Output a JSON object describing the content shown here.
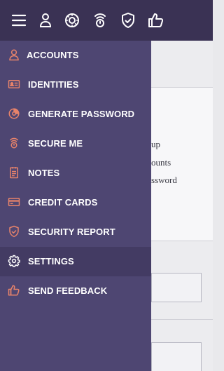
{
  "topbar": {
    "icons": [
      "hamburger-menu-icon",
      "account-icon",
      "generate-password-icon",
      "secure-me-icon",
      "security-shield-icon",
      "thumbs-up-icon"
    ]
  },
  "menu": {
    "items": [
      {
        "label": "ACCOUNTS",
        "icon": "user-icon"
      },
      {
        "label": "IDENTITIES",
        "icon": "id-card-icon"
      },
      {
        "label": "GENERATE PASSWORD",
        "icon": "password-dial-icon"
      },
      {
        "label": "SECURE ME",
        "icon": "secure-me-icon"
      },
      {
        "label": "NOTES",
        "icon": "notes-icon"
      },
      {
        "label": "CREDIT CARDS",
        "icon": "credit-card-icon"
      },
      {
        "label": "SECURITY REPORT",
        "icon": "shield-check-icon"
      },
      {
        "label": "SETTINGS",
        "icon": "gear-icon"
      },
      {
        "label": "SEND FEEDBACK",
        "icon": "thumbs-up-icon"
      }
    ],
    "active_item": "SETTINGS"
  },
  "background_page": {
    "lines": [
      "up",
      "ounts",
      "ssword"
    ]
  },
  "colors": {
    "topbar": "#3a3254",
    "drawer": "#4e4672",
    "active_row": "#433b63",
    "icon_accent": "#e8836a",
    "text": "#ffffff"
  }
}
